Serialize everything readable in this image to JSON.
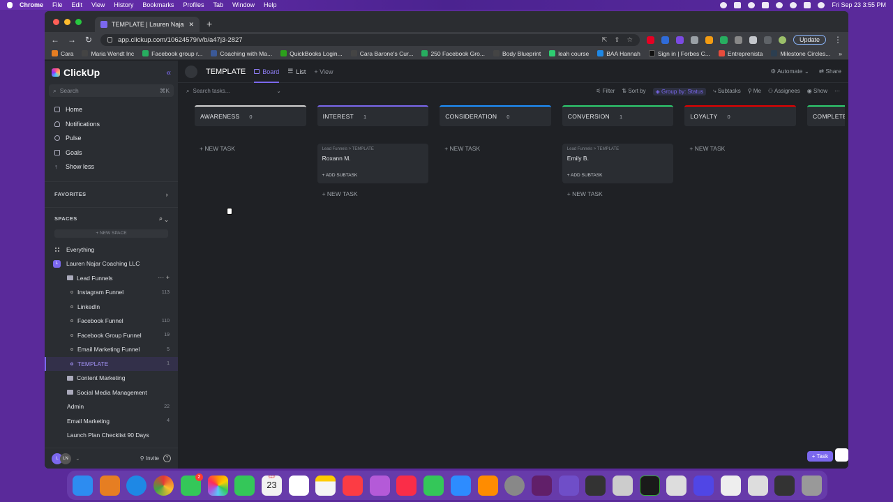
{
  "menubar": {
    "app": "Chrome",
    "items": [
      "File",
      "Edit",
      "View",
      "History",
      "Bookmarks",
      "Profiles",
      "Tab",
      "Window",
      "Help"
    ],
    "clock": "Fri Sep 23  3:55 PM"
  },
  "browser": {
    "tab_title": "TEMPLATE | Lauren Najar's Wo",
    "url": "app.clickup.com/10624579/v/b/a47j3-2827",
    "update_label": "Update",
    "bookmarks": [
      {
        "label": "Cara",
        "color": "#e67e22"
      },
      {
        "label": "Maria Wendt Inc",
        "color": "#444"
      },
      {
        "label": "Facebook group r...",
        "color": "#27ae60"
      },
      {
        "label": "Coaching with Ma...",
        "color": "#3b5998"
      },
      {
        "label": "QuickBooks Login...",
        "color": "#2ca01c"
      },
      {
        "label": "Cara Barone's Cur...",
        "color": "#444"
      },
      {
        "label": "250 Facebook Gro...",
        "color": "#27ae60"
      },
      {
        "label": "Body Blueprint",
        "color": "#444"
      },
      {
        "label": "leah course",
        "color": "#2ecc71"
      },
      {
        "label": "BAA Hannah",
        "color": "#1e88e5"
      },
      {
        "label": "Sign in | Forbes C...",
        "color": "#111"
      },
      {
        "label": "Entreprenista",
        "color": "#e74c3c"
      },
      {
        "label": "Milestone Circles...",
        "color": "#2c3e50"
      }
    ]
  },
  "sidebar": {
    "brand": "ClickUp",
    "search_placeholder": "Search",
    "search_kbd": "⌘K",
    "nav": [
      "Home",
      "Notifications",
      "Pulse",
      "Goals",
      "Show less"
    ],
    "favorites": "FAVORITES",
    "spaces": "SPACES",
    "new_space": "+ NEW SPACE",
    "everything": "Everything",
    "workspace": "Lauren Najar Coaching LLC",
    "workspace_initial": "L",
    "folder": "Lead Funnels",
    "lists": [
      {
        "label": "Instagram Funnel",
        "count": "113"
      },
      {
        "label": "LinkedIn",
        "count": ""
      },
      {
        "label": "Facebook Funnel",
        "count": "110"
      },
      {
        "label": "Facebook Group Funnel",
        "count": "19"
      },
      {
        "label": "Email Marketing Funnel",
        "count": "5"
      },
      {
        "label": "TEMPLATE",
        "count": "1"
      }
    ],
    "folders": [
      "Content Marketing",
      "Social Media Management"
    ],
    "others": [
      {
        "label": "Admin",
        "count": "22"
      },
      {
        "label": "Email Marketing",
        "count": "4"
      },
      {
        "label": "Launch Plan Checklist 90 Days",
        "count": ""
      }
    ],
    "avatar": "L",
    "avatar2": "LN",
    "invite": "Invite"
  },
  "header": {
    "title": "TEMPLATE",
    "tabs": [
      "Board",
      "List",
      "+ View"
    ],
    "automate": "Automate",
    "share": "Share"
  },
  "filters": {
    "search_placeholder": "Search tasks...",
    "items": [
      "Filter",
      "Sort by",
      "Group by: Status",
      "Subtasks",
      "Me",
      "Assignees",
      "Show"
    ]
  },
  "columns": [
    {
      "name": "AWARENESS",
      "count": "0",
      "color": "#d3d3d3",
      "cards": []
    },
    {
      "name": "INTEREST",
      "count": "1",
      "color": "#7b68ee",
      "cards": [
        {
          "path": "Lead Funnels  >  TEMPLATE",
          "name": "Roxann M.",
          "sub": "+ ADD SUBTASK"
        }
      ]
    },
    {
      "name": "CONSIDERATION",
      "count": "0",
      "color": "#1e90ff",
      "cards": []
    },
    {
      "name": "CONVERSION",
      "count": "1",
      "color": "#2ecd6f",
      "cards": [
        {
          "path": "Lead Funnels  >  TEMPLATE",
          "name": "Emily B.",
          "sub": "+ ADD SUBTASK"
        }
      ]
    },
    {
      "name": "LOYALTY",
      "count": "0",
      "color": "#e50000",
      "cards": []
    },
    {
      "name": "COMPLETE",
      "count": "",
      "color": "#2ecd6f",
      "cards": []
    }
  ],
  "new_task": "+ NEW TASK",
  "task_button": "+ Task",
  "dock": {
    "colors": [
      "#2d8cf0",
      "#e67e22",
      "#1e88e5",
      "#e53935",
      "#34c759",
      "#ff9500",
      "#34c759",
      "#f2f2f2",
      "#ffffff",
      "#f5f5f5",
      "#ffcc00",
      "#fc3c44",
      "#b45ad8",
      "#fa2d48",
      "#34c759",
      "#2d8cff",
      "#ff8c00",
      "#888888",
      "#611f69",
      "#6f4ec8",
      "#333333",
      "#cccccc",
      "#1a1a1a",
      "#dddddd",
      "#5046e5",
      "#eeeeee",
      "#dddddd",
      "#cccccc",
      "#999999"
    ],
    "calendar_month": "SEP",
    "calendar_day": "23",
    "messages_badge": "2"
  }
}
